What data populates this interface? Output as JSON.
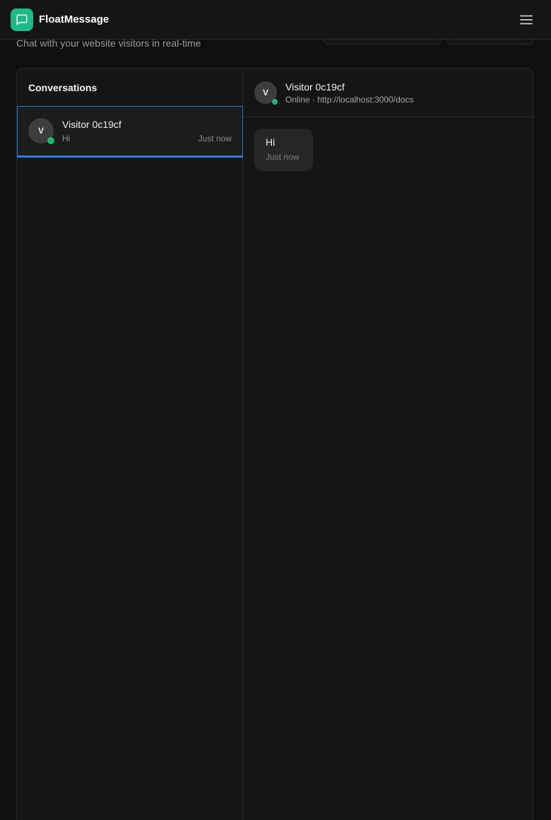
{
  "app": {
    "brand": "FloatMessage",
    "subtitle": "Chat with your website visitors in real-time"
  },
  "icons": {
    "logo": "chat-bubble-icon",
    "menu": "hamburger-menu-icon"
  },
  "colors": {
    "accent": "#1fb985",
    "selection": "#2673d9",
    "online": "#1db874"
  },
  "conversations": {
    "title": "Conversations",
    "items": [
      {
        "avatar": "V",
        "name": "Visitor 0c19cf",
        "preview": "Hi",
        "time": "Just now",
        "online": true,
        "selected": true
      }
    ]
  },
  "chat": {
    "avatar": "V",
    "name": "Visitor 0c19cf",
    "status": "Online · http://localhost:3000/docs",
    "messages": [
      {
        "text": "Hi",
        "time": "Just now"
      }
    ]
  }
}
